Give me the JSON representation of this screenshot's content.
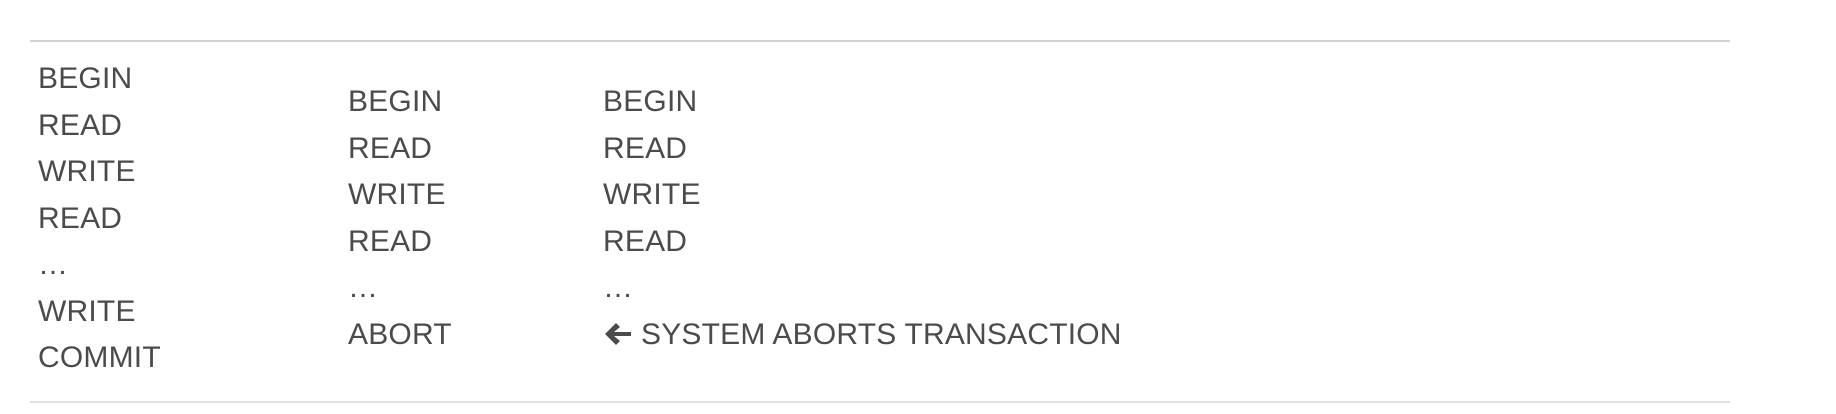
{
  "columns": [
    {
      "name": "transaction-1",
      "lines": [
        "BEGIN",
        "READ",
        "WRITE",
        "READ",
        "…",
        "WRITE",
        "COMMIT"
      ]
    },
    {
      "name": "transaction-2",
      "lines": [
        "BEGIN",
        "READ",
        "WRITE",
        "READ",
        "…",
        "ABORT"
      ]
    },
    {
      "name": "transaction-3",
      "lines": [
        "BEGIN",
        "READ",
        "WRITE",
        "READ",
        "…"
      ],
      "system_abort_icon": "arrow-left-icon",
      "system_abort_text": "SYSTEM ABORTS TRANSACTION"
    }
  ]
}
